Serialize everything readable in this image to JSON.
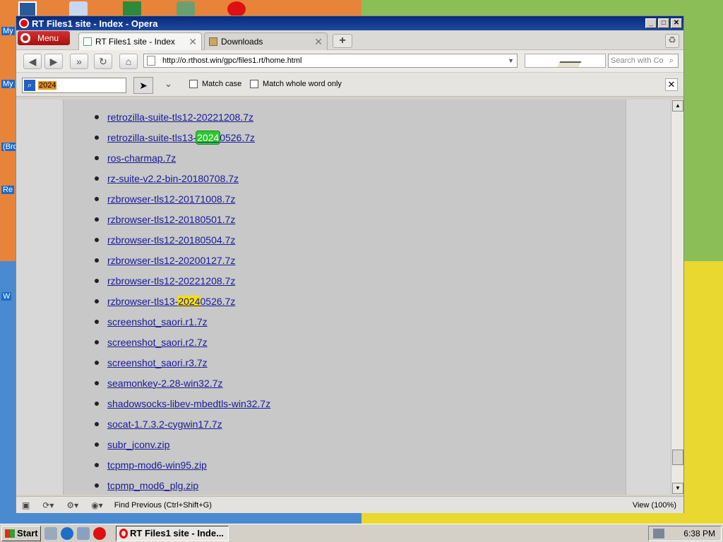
{
  "desktop": {
    "labels": [
      "My",
      "My",
      "(Bro",
      "Re",
      "W"
    ]
  },
  "window": {
    "title": "RT Files1 site - Index - Opera"
  },
  "tabs": {
    "menu_label": "Menu",
    "active_tab": "RT Files1 site - Index",
    "inactive_tab": "Downloads",
    "close": "✕",
    "new_tab": "+"
  },
  "nav": {
    "url": "http://o.rthost.win/gpc/files1.rt/home.html",
    "search_placeholder": "Search with Co"
  },
  "findbar": {
    "query": "2024",
    "match_case": "Match case",
    "whole_word": "Match whole word only"
  },
  "files": [
    "retrozilla-suite-tls12-20221208.7z",
    "retrozilla-suite-tls13-",
    "2024",
    "0526.7z",
    "ros-charmap.7z",
    "rz-suite-v2.2-bin-20180708.7z",
    "rzbrowser-tls12-20171008.7z",
    "rzbrowser-tls12-20180501.7z",
    "rzbrowser-tls12-20180504.7z",
    "rzbrowser-tls12-20200127.7z",
    "rzbrowser-tls12-20221208.7z",
    "rzbrowser-tls13-",
    "2024",
    "0526.7z",
    "screenshot_saori.r1.7z",
    "screenshot_saori.r2.7z",
    "screenshot_saori.r3.7z",
    "seamonkey-2.28-win32.7z",
    "shadowsocks-libev-mbedtls-win32.7z",
    "socat-1.7.3.2-cygwin17.7z",
    "subr_jconv.zip",
    "tcpmp-mod6-win95.zip",
    "tcpmp_mod6_plg.zip"
  ],
  "status": {
    "find_previous": "Find Previous (Ctrl+Shift+G)",
    "zoom": "View (100%)"
  },
  "taskbar": {
    "start": "Start",
    "task": "RT Files1 site - Inde...",
    "clock": "6:38 PM"
  }
}
